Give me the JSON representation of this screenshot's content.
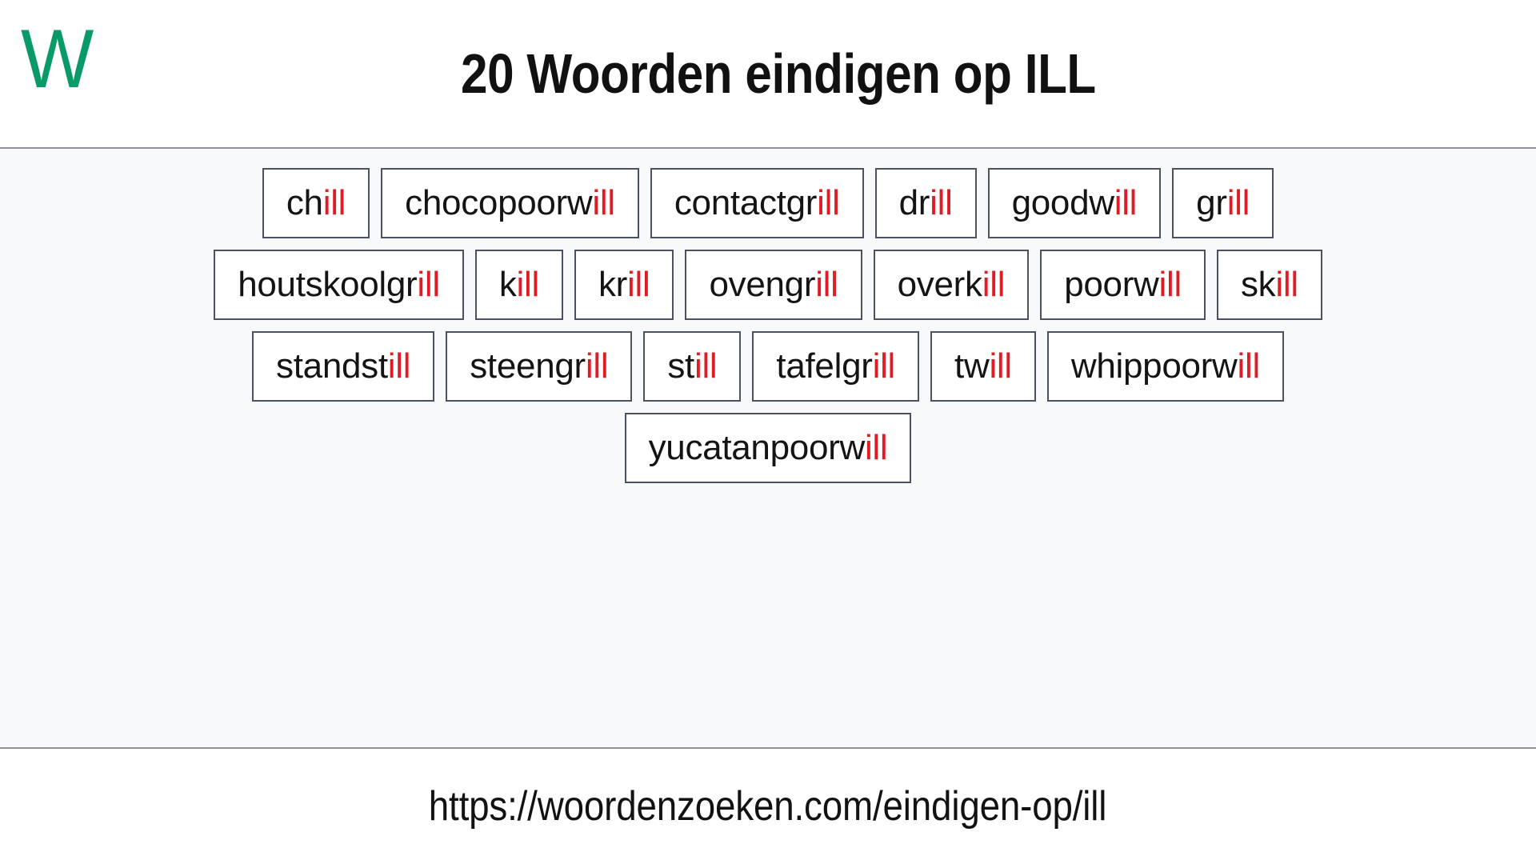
{
  "header": {
    "logo_text": "W",
    "logo_color": "#0a9a68",
    "title": "20 Woorden eindigen op ILL"
  },
  "theme": {
    "body_background": "#f7f9fb",
    "box_background": "#ffffff",
    "box_border": "#4a5160",
    "text_color": "#141414",
    "suffix_color": "#e01b24",
    "divider_color": "#8c9199"
  },
  "word_grid": {
    "suffix": "ill",
    "total_count": 20,
    "rows": [
      [
        {
          "prefix": "ch",
          "suffix": "ill",
          "full": "chill"
        },
        {
          "prefix": "chocopoorw",
          "suffix": "ill",
          "full": "chocopoorwill"
        },
        {
          "prefix": "contactgr",
          "suffix": "ill",
          "full": "contactgrill"
        },
        {
          "prefix": "dr",
          "suffix": "ill",
          "full": "drill"
        },
        {
          "prefix": "goodw",
          "suffix": "ill",
          "full": "goodwill"
        },
        {
          "prefix": "gr",
          "suffix": "ill",
          "full": "grill"
        }
      ],
      [
        {
          "prefix": "houtskoolgr",
          "suffix": "ill",
          "full": "houtskoolgrill"
        },
        {
          "prefix": "k",
          "suffix": "ill",
          "full": "kill"
        },
        {
          "prefix": "kr",
          "suffix": "ill",
          "full": "krill"
        },
        {
          "prefix": "ovengr",
          "suffix": "ill",
          "full": "ovengrill"
        },
        {
          "prefix": "overk",
          "suffix": "ill",
          "full": "overkill"
        },
        {
          "prefix": "poorw",
          "suffix": "ill",
          "full": "poorwill"
        },
        {
          "prefix": "sk",
          "suffix": "ill",
          "full": "skill"
        }
      ],
      [
        {
          "prefix": "standst",
          "suffix": "ill",
          "full": "standstill"
        },
        {
          "prefix": "steengr",
          "suffix": "ill",
          "full": "steengrill"
        },
        {
          "prefix": "st",
          "suffix": "ill",
          "full": "still"
        },
        {
          "prefix": "tafelgr",
          "suffix": "ill",
          "full": "tafelgrill"
        },
        {
          "prefix": "tw",
          "suffix": "ill",
          "full": "twill"
        },
        {
          "prefix": "whippoorw",
          "suffix": "ill",
          "full": "whippoorwill"
        }
      ],
      [
        {
          "prefix": "yucatanpoorw",
          "suffix": "ill",
          "full": "yucatanpoorwill"
        }
      ]
    ]
  },
  "footer": {
    "url": "https://woordenzoeken.com/eindigen-op/ill"
  }
}
